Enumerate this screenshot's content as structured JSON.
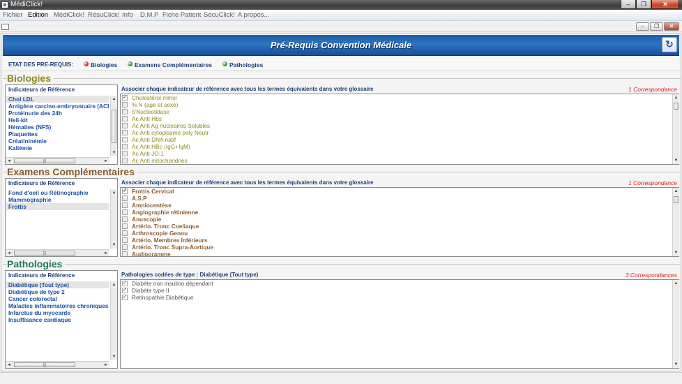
{
  "window": {
    "title": "MédiClick!"
  },
  "menu": [
    "Fichier",
    "Edition",
    "MédiClick!",
    "RésuClick!",
    "Info",
    "D.M.P",
    "Fiche Patient",
    "SécuClick!",
    "A propos..."
  ],
  "banner": {
    "title": "Pré-Requis Convention Médicale"
  },
  "status": {
    "label": "ETAT DES PRE-REQUIS:",
    "items": [
      {
        "label": "Biologies",
        "color": "#cc1a1a"
      },
      {
        "label": "Examens Complémentaires",
        "color": "#1a9a1a"
      },
      {
        "label": "Pathologies",
        "color": "#1a9a1a"
      }
    ]
  },
  "sections": {
    "biologies": {
      "title": "Biologies",
      "color": "#8c8a18",
      "ind_header": "Indicateurs de Référence",
      "indicators": [
        "Chol LDL",
        "Antigène carcino-embryonnaire (ACE)",
        "Protéinurie des 24h",
        "Heli-kit",
        "Hématies (NFS)",
        "Plaquettes",
        "Créatininémie",
        "Kaliémie"
      ],
      "selected_index": 0,
      "glossary_header": "Associer chaque indicateur de référence avec tous les termes équivalents dans votre glossaire",
      "count": "1 Correspondance",
      "terms": [
        {
          "label": "Cholestérol mmol",
          "checked": true
        },
        {
          "label": "% N (age et sexe)",
          "checked": false
        },
        {
          "label": "5'Nucleotidase",
          "checked": false
        },
        {
          "label": "Ac Anti  Hbs",
          "checked": false
        },
        {
          "label": "Ac Anti Ag nucleaires Solubles",
          "checked": false
        },
        {
          "label": "Ac Anti cytoplasme poly Neutr",
          "checked": false
        },
        {
          "label": "Ac Anti DNA natif",
          "checked": false
        },
        {
          "label": "Ac Anti HBc (IgG+IgM)",
          "checked": false
        },
        {
          "label": "Ac Anti JO-1",
          "checked": false
        },
        {
          "label": "Ac Anti mitochondries",
          "checked": false
        }
      ]
    },
    "examens": {
      "title": "Examens Complémentaires",
      "color": "#8a5a2a",
      "ind_header": "Indicateurs de Référence",
      "indicators": [
        "Fond d'oeil ou Rétinographie",
        "Mammographie",
        "Frottis"
      ],
      "selected_index": 2,
      "glossary_header": "Associer chaque indicateur de référence avec tous les termes équivalents dans votre glossaire",
      "count": "1 Correspondance",
      "terms": [
        {
          "label": "Frottis Cervical",
          "checked": true
        },
        {
          "label": "A.S.P",
          "checked": false
        },
        {
          "label": "Amniocentèse",
          "checked": false
        },
        {
          "label": "Angiographie rétinienne",
          "checked": false
        },
        {
          "label": "Anuscopie",
          "checked": false
        },
        {
          "label": "Artério. Tronc Coeliaque",
          "checked": false
        },
        {
          "label": "Arthroscopie Genou",
          "checked": false
        },
        {
          "label": "Artério. Membres Inférieurs",
          "checked": false
        },
        {
          "label": "Artério. Tronc Supra-Aortique",
          "checked": false
        },
        {
          "label": "Audiogramme",
          "checked": false
        }
      ]
    },
    "pathologies": {
      "title": "Pathologies",
      "color": "#1a7a5a",
      "ind_header": "Indicateurs de Référence",
      "indicators": [
        "Diabétique (Tout type)",
        "Diabétique de type 2",
        "Cancer colorectal",
        "Maladies inflammatoires chroniques",
        "Infarctus du myocarde",
        "Insuffisance cardiaque"
      ],
      "selected_index": 0,
      "glossary_header": "Pathologies codées de type : Diabétique (Tout type)",
      "count": "3 Correspondances",
      "terms": [
        {
          "label": "Diabète non insulino dépendant",
          "checked": true
        },
        {
          "label": "Diabète type II",
          "checked": true
        },
        {
          "label": "Retinopathie Diabétique",
          "checked": true
        }
      ]
    }
  },
  "glyphs": {
    "check": "✓",
    "up": "▲",
    "down": "▼",
    "left": "◄",
    "right": "►",
    "grip": "|||",
    "min": "–",
    "restore": "❐",
    "close": "✕"
  }
}
